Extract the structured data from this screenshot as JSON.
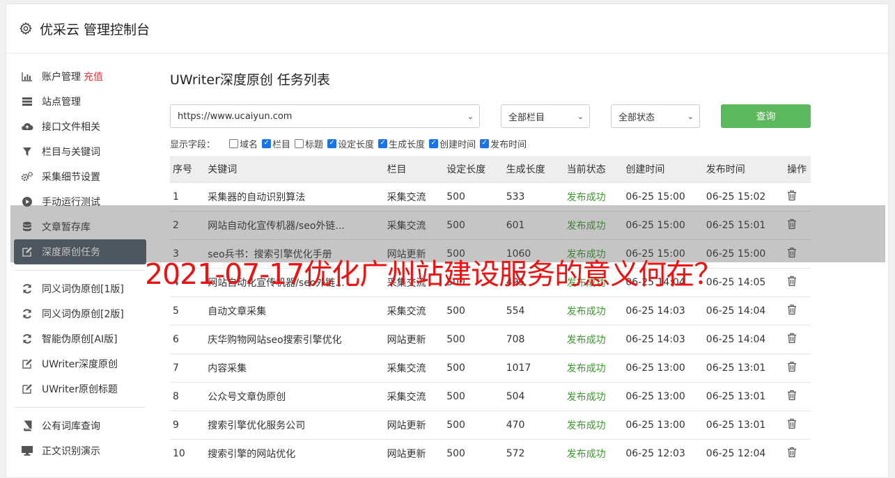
{
  "app": {
    "title": "优采云 管理控制台",
    "icon": "gear-icon"
  },
  "sidebar": {
    "groups": [
      [
        {
          "label": "账户管理",
          "accent": "充值",
          "icon": "bar-chart-icon"
        },
        {
          "label": "站点管理",
          "icon": "server-icon"
        },
        {
          "label": "接口文件相关",
          "icon": "cloud-upload-icon"
        },
        {
          "label": "栏目与关键词",
          "icon": "filter-icon"
        },
        {
          "label": "采集细节设置",
          "icon": "cogs-icon"
        },
        {
          "label": "手动运行测试",
          "icon": "play-circle-icon"
        },
        {
          "label": "文章暂存库",
          "icon": "database-icon"
        },
        {
          "label": "深度原创任务",
          "icon": "edit-icon",
          "active": true
        }
      ],
      [
        {
          "label": "同义词伪原创[1版]",
          "icon": "refresh-icon"
        },
        {
          "label": "同义词伪原创[2版]",
          "icon": "refresh-icon"
        },
        {
          "label": "智能伪原创[AI版]",
          "icon": "refresh-icon"
        },
        {
          "label": "UWriter深度原创",
          "icon": "edit-icon"
        },
        {
          "label": "UWriter原创标题",
          "icon": "edit-icon"
        }
      ],
      [
        {
          "label": "公有词库查询",
          "icon": "book-icon"
        },
        {
          "label": "正文识别演示",
          "icon": "monitor-icon"
        }
      ]
    ]
  },
  "main": {
    "title": "UWriter深度原创 任务列表",
    "site_select": "https://www.ucaiyun.com",
    "column_select": "全部栏目",
    "status_select": "全部状态",
    "query_label": "查询",
    "fields_label": "显示字段：",
    "fields": [
      {
        "label": "域名",
        "checked": false
      },
      {
        "label": "栏目",
        "checked": true
      },
      {
        "label": "标题",
        "checked": false
      },
      {
        "label": "设定长度",
        "checked": true
      },
      {
        "label": "生成长度",
        "checked": true
      },
      {
        "label": "创建时间",
        "checked": true
      },
      {
        "label": "发布时间",
        "checked": true
      }
    ],
    "columns": [
      "序号",
      "关键词",
      "栏目",
      "设定长度",
      "生成长度",
      "当前状态",
      "创建时间",
      "发布时间",
      "操作"
    ],
    "rows": [
      [
        "1",
        "采集器的自动识别算法",
        "采集交流",
        "500",
        "533",
        "发布成功",
        "06-25 15:00",
        "06-25 15:02"
      ],
      [
        "2",
        "网站自动化宣传机器/seo外链...",
        "采集交流",
        "500",
        "601",
        "发布成功",
        "06-25 15:00",
        "06-25 15:01"
      ],
      [
        "3",
        "seo兵书：搜索引擎优化手册",
        "网站更新",
        "500",
        "1060",
        "发布成功",
        "06-25 15:00",
        "06-25 15:00"
      ],
      [
        "4",
        "网站自动化宣传机器/seo外链...",
        "采集交流",
        "500",
        "495",
        "发布成功",
        "06-25 14:04",
        "06-25 14:05"
      ],
      [
        "5",
        "自动文章采集",
        "采集交流",
        "500",
        "554",
        "发布成功",
        "06-25 14:03",
        "06-25 14:04"
      ],
      [
        "6",
        "庆华购物网站seo搜索引擎优化",
        "网站更新",
        "500",
        "708",
        "发布成功",
        "06-25 14:03",
        "06-25 14:04"
      ],
      [
        "7",
        "内容采集",
        "采集交流",
        "500",
        "1017",
        "发布成功",
        "06-25 13:00",
        "06-25 13:01"
      ],
      [
        "8",
        "公众号文章伪原创",
        "采集交流",
        "500",
        "504",
        "发布成功",
        "06-25 13:00",
        "06-25 13:01"
      ],
      [
        "9",
        "搜索引擎优化服务公司",
        "网站更新",
        "500",
        "470",
        "发布成功",
        "06-25 13:00",
        "06-25 13:01"
      ],
      [
        "10",
        "搜索引擎的网站优化",
        "网站更新",
        "500",
        "572",
        "发布成功",
        "06-25 12:03",
        "06-25 12:04"
      ]
    ],
    "action_icon": "trash-icon"
  },
  "overlay_headline": "2021-07-17优化广州站建设服务的意义何在？",
  "colors": {
    "accent_red": "#e4393c",
    "success_green": "#3c9a2e",
    "query_button": "#5cb85c",
    "active_nav": "#4d5966"
  }
}
